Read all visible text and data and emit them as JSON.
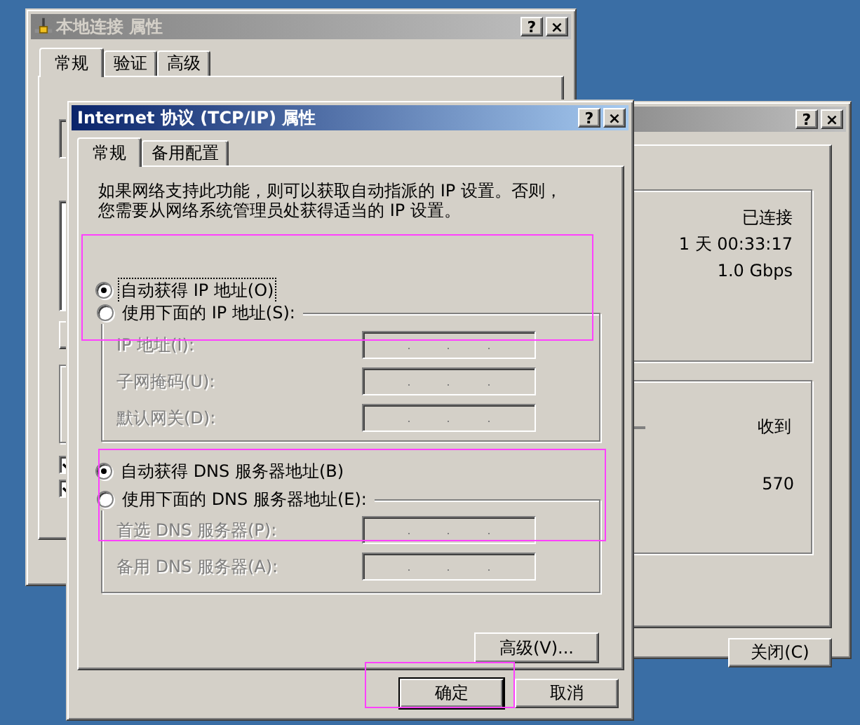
{
  "connection_window": {
    "title": "本地连接 属性",
    "active": false,
    "title_buttons": [
      "?",
      "×"
    ],
    "tabs": [
      {
        "label": "常规",
        "selected": true
      },
      {
        "label": "验证",
        "selected": false
      },
      {
        "label": "高级",
        "selected": false
      }
    ],
    "checkboxes": [
      {
        "checked": true
      },
      {
        "checked": true
      }
    ]
  },
  "status_window": {
    "active": false,
    "title_buttons": [
      "?",
      "×"
    ],
    "status_values": [
      "已连接",
      "1 天 00:33:17",
      "1.0 Gbps"
    ],
    "activity_label": "收到",
    "activity_value": "570",
    "close_button": "关闭(C)"
  },
  "tcpip_dialog": {
    "title": "Internet 协议 (TCP/IP) 属性",
    "active": true,
    "title_buttons": [
      "?",
      "×"
    ],
    "tabs": [
      {
        "label": "常规",
        "selected": true
      },
      {
        "label": "备用配置",
        "selected": false
      }
    ],
    "description_lines": [
      "如果网络支持此功能，则可以获取自动指派的 IP 设置。否则，",
      "您需要从网络系统管理员处获得适当的 IP 设置。"
    ],
    "ip_auto_radio": {
      "label": "自动获得 IP 地址(O)",
      "selected": true,
      "focused": true
    },
    "ip_manual_radio": {
      "label": "使用下面的 IP 地址(S):",
      "selected": false,
      "focused": false
    },
    "ip_fields": [
      {
        "label": "IP 地址(I):",
        "disabled": true
      },
      {
        "label": "子网掩码(U):",
        "disabled": true
      },
      {
        "label": "默认网关(D):",
        "disabled": true
      }
    ],
    "dns_auto_radio": {
      "label": "自动获得 DNS 服务器地址(B)",
      "selected": true,
      "focused": false
    },
    "dns_manual_radio": {
      "label": "使用下面的 DNS 服务器地址(E):",
      "selected": false,
      "focused": false
    },
    "dns_fields": [
      {
        "label": "首选 DNS 服务器(P):",
        "disabled": true
      },
      {
        "label": "备用 DNS 服务器(A):",
        "disabled": true
      }
    ],
    "advanced_button": "高级(V)...",
    "buttons": [
      {
        "label": "确定",
        "default": true
      },
      {
        "label": "取消",
        "default": false
      }
    ]
  }
}
